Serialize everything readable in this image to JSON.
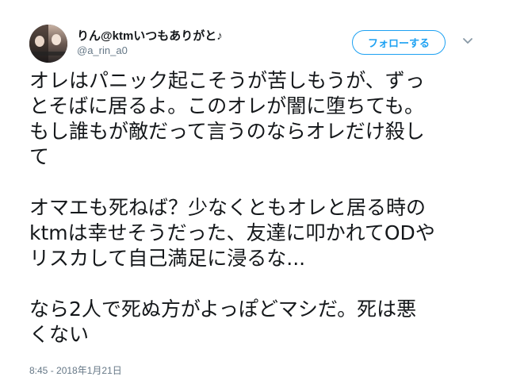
{
  "user": {
    "display_name": "りん@ktmいつもありがと♪",
    "handle": "@a_rin_a0"
  },
  "follow_button": {
    "label": "フォローする"
  },
  "icons": {
    "caret": "chevron-down-icon",
    "avatar": "user-avatar"
  },
  "tweet": {
    "lines": [
      "オレはパニック起こそうが苦しもうが、ずっ",
      "とそばに居るよ。このオレが闇に堕ちても。",
      "もし誰もが敵だって言うのならオレだけ殺し",
      "て",
      "",
      "オマエも死ねば？少なくともオレと居る時の",
      "ktmは幸せそうだった、友達に叩かれてODや",
      "リスカして自己満足に浸るな...",
      "",
      "なら2人で死ぬ方がよっぽどマシだ。死は悪",
      "くない"
    ],
    "timestamp": "8:45 - 2018年1月21日"
  },
  "colors": {
    "accent": "#1da1f2",
    "text": "#14171a",
    "muted": "#657786"
  }
}
